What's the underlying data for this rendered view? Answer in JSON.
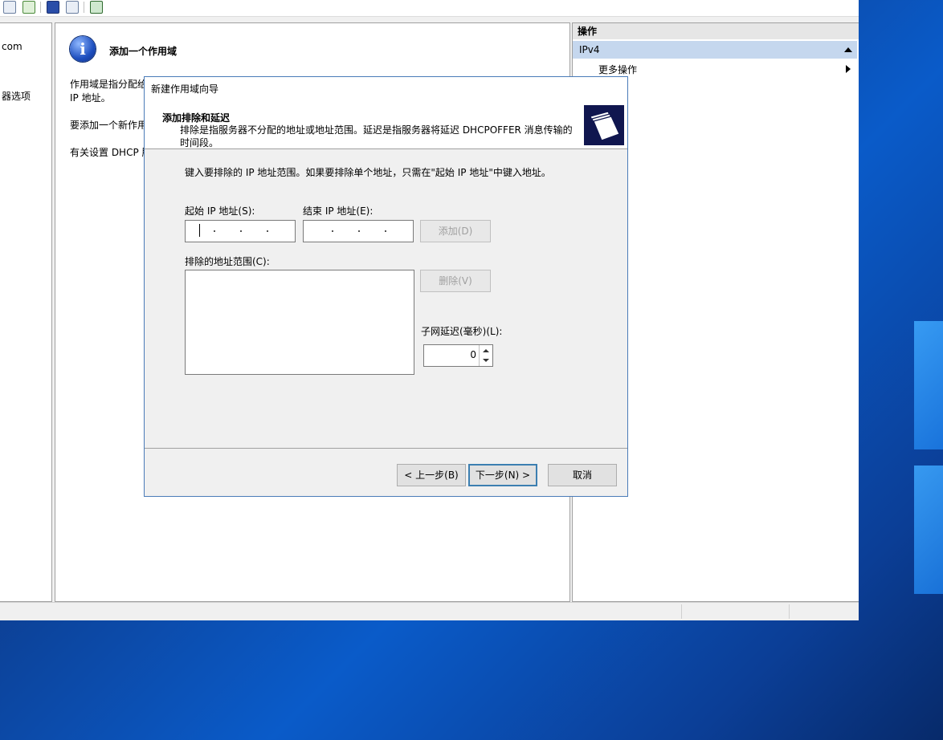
{
  "mmc": {
    "tree": {
      "items": [
        "com",
        "器选项"
      ]
    },
    "center": {
      "title": "添加一个作用域",
      "paragraphs": [
        "作用域是指分配给",
        "IP 地址。",
        "要添加一个新作用",
        "有关设置 DHCP 服"
      ]
    },
    "actions": {
      "header": "操作",
      "selected": "IPv4",
      "more": "更多操作"
    }
  },
  "wizard": {
    "title": "新建作用域向导",
    "header_title": "添加排除和延迟",
    "header_desc": "排除是指服务器不分配的地址或地址范围。延迟是指服务器将延迟 DHCPOFFER 消息传输的时间段。",
    "instruction": "键入要排除的 IP 地址范围。如果要排除单个地址，只需在\"起始 IP 地址\"中键入地址。",
    "start_ip_label": "起始 IP 地址(S):",
    "end_ip_label": "结束 IP 地址(E):",
    "add_button": "添加(D)",
    "excluded_label": "排除的地址范围(C):",
    "delete_button": "删除(V)",
    "delay_label": "子网延迟(毫秒)(L):",
    "delay_value": "0",
    "back_button": "< 上一步(B)",
    "next_button": "下一步(N) >",
    "cancel_button": "取消"
  }
}
